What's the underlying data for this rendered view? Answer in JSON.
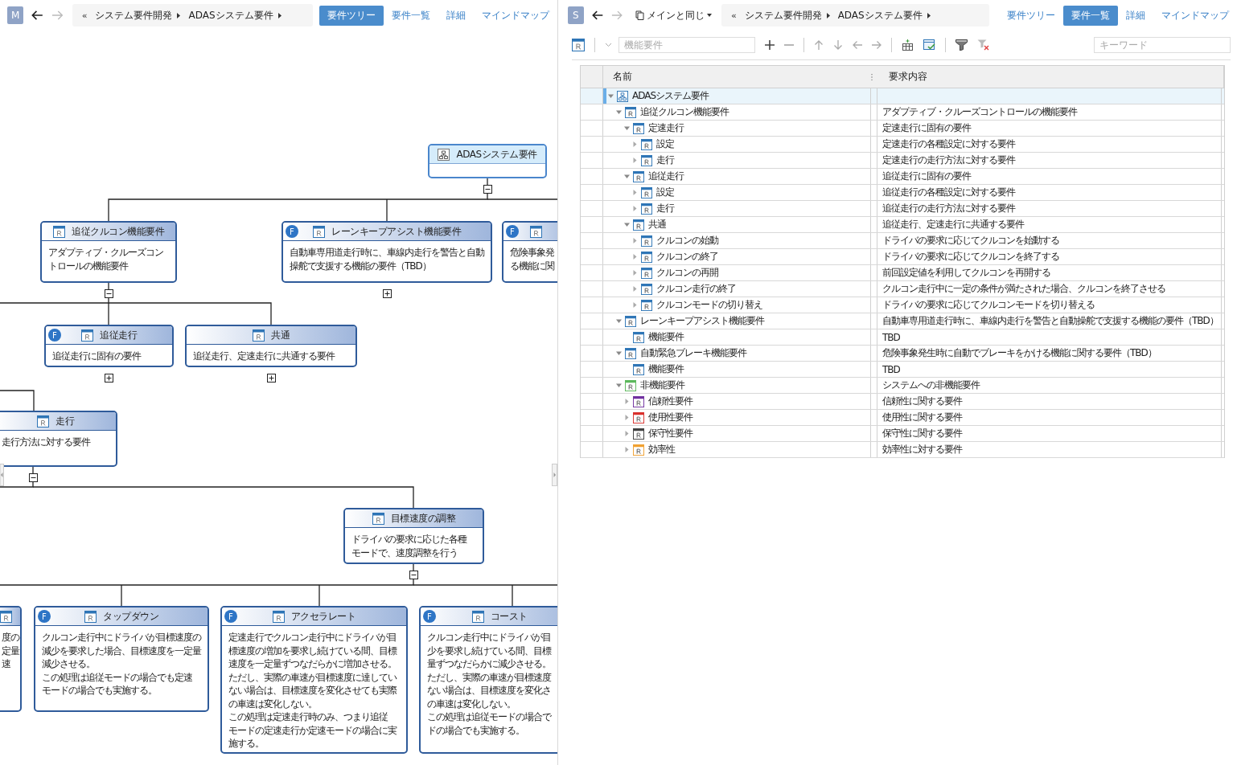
{
  "left": {
    "avatar": "M",
    "breadcrumb": {
      "back": "«",
      "items": [
        "システム要件開発",
        "ADASシステム要件"
      ]
    },
    "tabs": [
      {
        "label": "要件ツリー",
        "selected": true
      },
      {
        "label": "要件一覧",
        "selected": false
      },
      {
        "label": "詳細",
        "selected": false
      },
      {
        "label": "マインドマップ",
        "selected": false
      }
    ],
    "nodes": [
      {
        "kind": "system",
        "title": "ADASシステム要件",
        "expanded": true
      },
      {
        "kind": "requirement",
        "title": "追従クルコン機能要件",
        "lines": [
          "アダプティブ・クルーズコン",
          "トロールの機能要件"
        ],
        "expanded": true
      },
      {
        "kind": "requirement",
        "badge": "F",
        "title": "レーンキープアシスト機能要件",
        "lines": [
          "自動車専用道走行時に、車線内走行を警告と自動",
          "操舵で支援する機能の要件（TBD）"
        ],
        "expanded": false
      },
      {
        "kind": "requirement",
        "badge": "F",
        "lines": [
          "危険事象発",
          "る機能に関"
        ]
      },
      {
        "kind": "requirement",
        "badge": "F",
        "title": "追従走行",
        "lines": [
          "追従走行に固有の要件"
        ],
        "expanded": false
      },
      {
        "kind": "requirement",
        "title": "共通",
        "lines": [
          "追従走行、定速走行に共通する要件"
        ],
        "expanded": false
      },
      {
        "kind": "requirement",
        "title": "走行",
        "lines": [
          "走行方法に対する要件"
        ],
        "expanded": true
      },
      {
        "kind": "requirement",
        "title": "目標速度の調整",
        "lines": [
          "ドライバの要求に応じた各種",
          "モードで、速度調整を行う"
        ],
        "expanded": true
      },
      {
        "kind": "requirement",
        "lines": [
          "度の",
          "定量",
          "速"
        ]
      },
      {
        "kind": "requirement",
        "badge": "F",
        "title": "タップダウン",
        "lines": [
          "クルコン走行中にドライバが目標速度の",
          "減少を要求した場合、目標速度を一定量",
          "減少させる。",
          "この処理は追従モードの場合でも定速",
          "モードの場合でも実施する。"
        ]
      },
      {
        "kind": "requirement",
        "badge": "F",
        "title": "アクセラレート",
        "lines": [
          "定速走行でクルコン走行中にドライバが目",
          "標速度の増加を要求し続けている間、目標",
          "速度を一定量ずつなだらかに増加させる。",
          "ただし、実際の車速が目標速度に達してい",
          "ない場合は、目標速度を変化させても実際",
          "の車速は変化しない。",
          "この処理は定速走行時のみ、つまり追従",
          "モードの定速走行か定速モードの場合に実",
          "施する。"
        ]
      },
      {
        "kind": "requirement",
        "badge": "F",
        "title": "コースト",
        "lines": [
          "クルコン走行中にドライバが目",
          "少を要求し続けている間、目標",
          "量ずつなだらかに減少させる。",
          "ただし、実際の車速が目標速度",
          "ない場合は、目標速度を変化さ",
          "の車速は変化しない。",
          "この処理は追従モードの場合で",
          "ドの場合でも実施する。"
        ]
      }
    ]
  },
  "right": {
    "avatar": "S",
    "view_select": "メインと同じ",
    "breadcrumb": {
      "back": "«",
      "items": [
        "システム要件開発",
        "ADASシステム要件"
      ]
    },
    "tabs": [
      {
        "label": "要件ツリー",
        "selected": false
      },
      {
        "label": "要件一覧",
        "selected": true
      },
      {
        "label": "詳細",
        "selected": false
      },
      {
        "label": "マインドマップ",
        "selected": false
      }
    ],
    "toolbar": {
      "type_field": {
        "placeholder": "機能要件"
      },
      "search": {
        "placeholder": "キーワード"
      }
    },
    "table": {
      "columns": [
        "名前",
        "要求内容"
      ],
      "rows": [
        {
          "kind": "system",
          "name": "ADASシステム要件",
          "selected": true,
          "expanded": true,
          "color": "#2e75b6",
          "children": [
            {
              "kind": "requirement",
              "name": "追従クルコン機能要件",
              "content": "アダプティブ・クルーズコントロールの機能要件",
              "selected": false,
              "expanded": true,
              "color": "#2e75b6",
              "children": [
                {
                  "kind": "requirement",
                  "name": "定速走行",
                  "content": "定速走行に固有の要件",
                  "selected": false,
                  "expanded": true,
                  "color": "#2e75b6",
                  "children": [
                    {
                      "kind": "requirement",
                      "name": "設定",
                      "content": "定速走行の各種設定に対する要件",
                      "selected": false,
                      "expanded": false,
                      "color": "#2e75b6"
                    },
                    {
                      "kind": "requirement",
                      "name": "走行",
                      "content": "定速走行の走行方法に対する要件",
                      "selected": false,
                      "expanded": false,
                      "color": "#2e75b6"
                    }
                  ]
                },
                {
                  "kind": "requirement",
                  "name": "追従走行",
                  "content": "追従走行に固有の要件",
                  "selected": false,
                  "expanded": true,
                  "color": "#2e75b6",
                  "children": [
                    {
                      "kind": "requirement",
                      "name": "設定",
                      "content": "追従走行の各種設定に対する要件",
                      "selected": false,
                      "expanded": false,
                      "color": "#2e75b6"
                    },
                    {
                      "kind": "requirement",
                      "name": "走行",
                      "content": "追従走行の走行方法に対する要件",
                      "selected": false,
                      "expanded": false,
                      "color": "#2e75b6"
                    }
                  ]
                },
                {
                  "kind": "requirement",
                  "name": "共通",
                  "content": "追従走行、定速走行に共通する要件",
                  "selected": false,
                  "expanded": true,
                  "color": "#2e75b6",
                  "children": [
                    {
                      "kind": "requirement",
                      "name": "クルコンの始動",
                      "content": "ドライバの要求に応じてクルコンを始動する",
                      "selected": false,
                      "expanded": false,
                      "color": "#2e75b6"
                    },
                    {
                      "kind": "requirement",
                      "name": "クルコンの終了",
                      "content": "ドライバの要求に応じてクルコンを終了する",
                      "selected": false,
                      "expanded": false,
                      "color": "#2e75b6"
                    },
                    {
                      "kind": "requirement",
                      "name": "クルコンの再開",
                      "content": "前回設定値を利用してクルコンを再開する",
                      "selected": false,
                      "expanded": false,
                      "color": "#2e75b6"
                    },
                    {
                      "kind": "requirement",
                      "name": "クルコン走行の終了",
                      "content": "クルコン走行中に一定の条件が満たされた場合、クルコンを終了させる",
                      "selected": false,
                      "expanded": false,
                      "color": "#2e75b6"
                    },
                    {
                      "kind": "requirement",
                      "name": "クルコンモードの切り替え",
                      "content": "ドライバの要求に応じてクルコンモードを切り替える",
                      "selected": false,
                      "expanded": false,
                      "color": "#2e75b6"
                    }
                  ]
                }
              ]
            },
            {
              "kind": "requirement",
              "name": "レーンキープアシスト機能要件",
              "content": "自動車専用道走行時に、車線内走行を警告と自動操舵で支援する機能の要件（TBD）",
              "selected": false,
              "expanded": true,
              "color": "#2e75b6",
              "children": [
                {
                  "kind": "requirement",
                  "name": "機能要件",
                  "content": "TBD",
                  "selected": false,
                  "color": "#2e75b6"
                }
              ]
            },
            {
              "kind": "requirement",
              "name": "自動緊急ブレーキ機能要件",
              "content": "危険事象発生時に自動でブレーキをかける機能に関する要件（TBD）",
              "selected": false,
              "expanded": true,
              "color": "#2e75b6",
              "children": [
                {
                  "kind": "requirement",
                  "name": "機能要件",
                  "content": "TBD",
                  "selected": false,
                  "color": "#2e75b6"
                }
              ]
            },
            {
              "kind": "requirement",
              "name": "非機能要件",
              "content": "システムへの非機能要件",
              "selected": false,
              "expanded": true,
              "color": "#5cb85c",
              "children": [
                {
                  "kind": "requirement",
                  "name": "信頼性要件",
                  "content": "信頼性に関する要件",
                  "selected": false,
                  "expanded": false,
                  "color": "#7030a0"
                },
                {
                  "kind": "requirement",
                  "name": "使用性要件",
                  "content": "使用性に関する要件",
                  "selected": false,
                  "expanded": false,
                  "color": "#d9302c"
                },
                {
                  "kind": "requirement",
                  "name": "保守性要件",
                  "content": "保守性に関する要件",
                  "selected": false,
                  "expanded": false,
                  "color": "#404040"
                },
                {
                  "kind": "requirement",
                  "name": "効率性",
                  "content": "効率性に対する要件",
                  "selected": false,
                  "expanded": false,
                  "color": "#f0a030"
                }
              ]
            }
          ]
        }
      ]
    }
  }
}
